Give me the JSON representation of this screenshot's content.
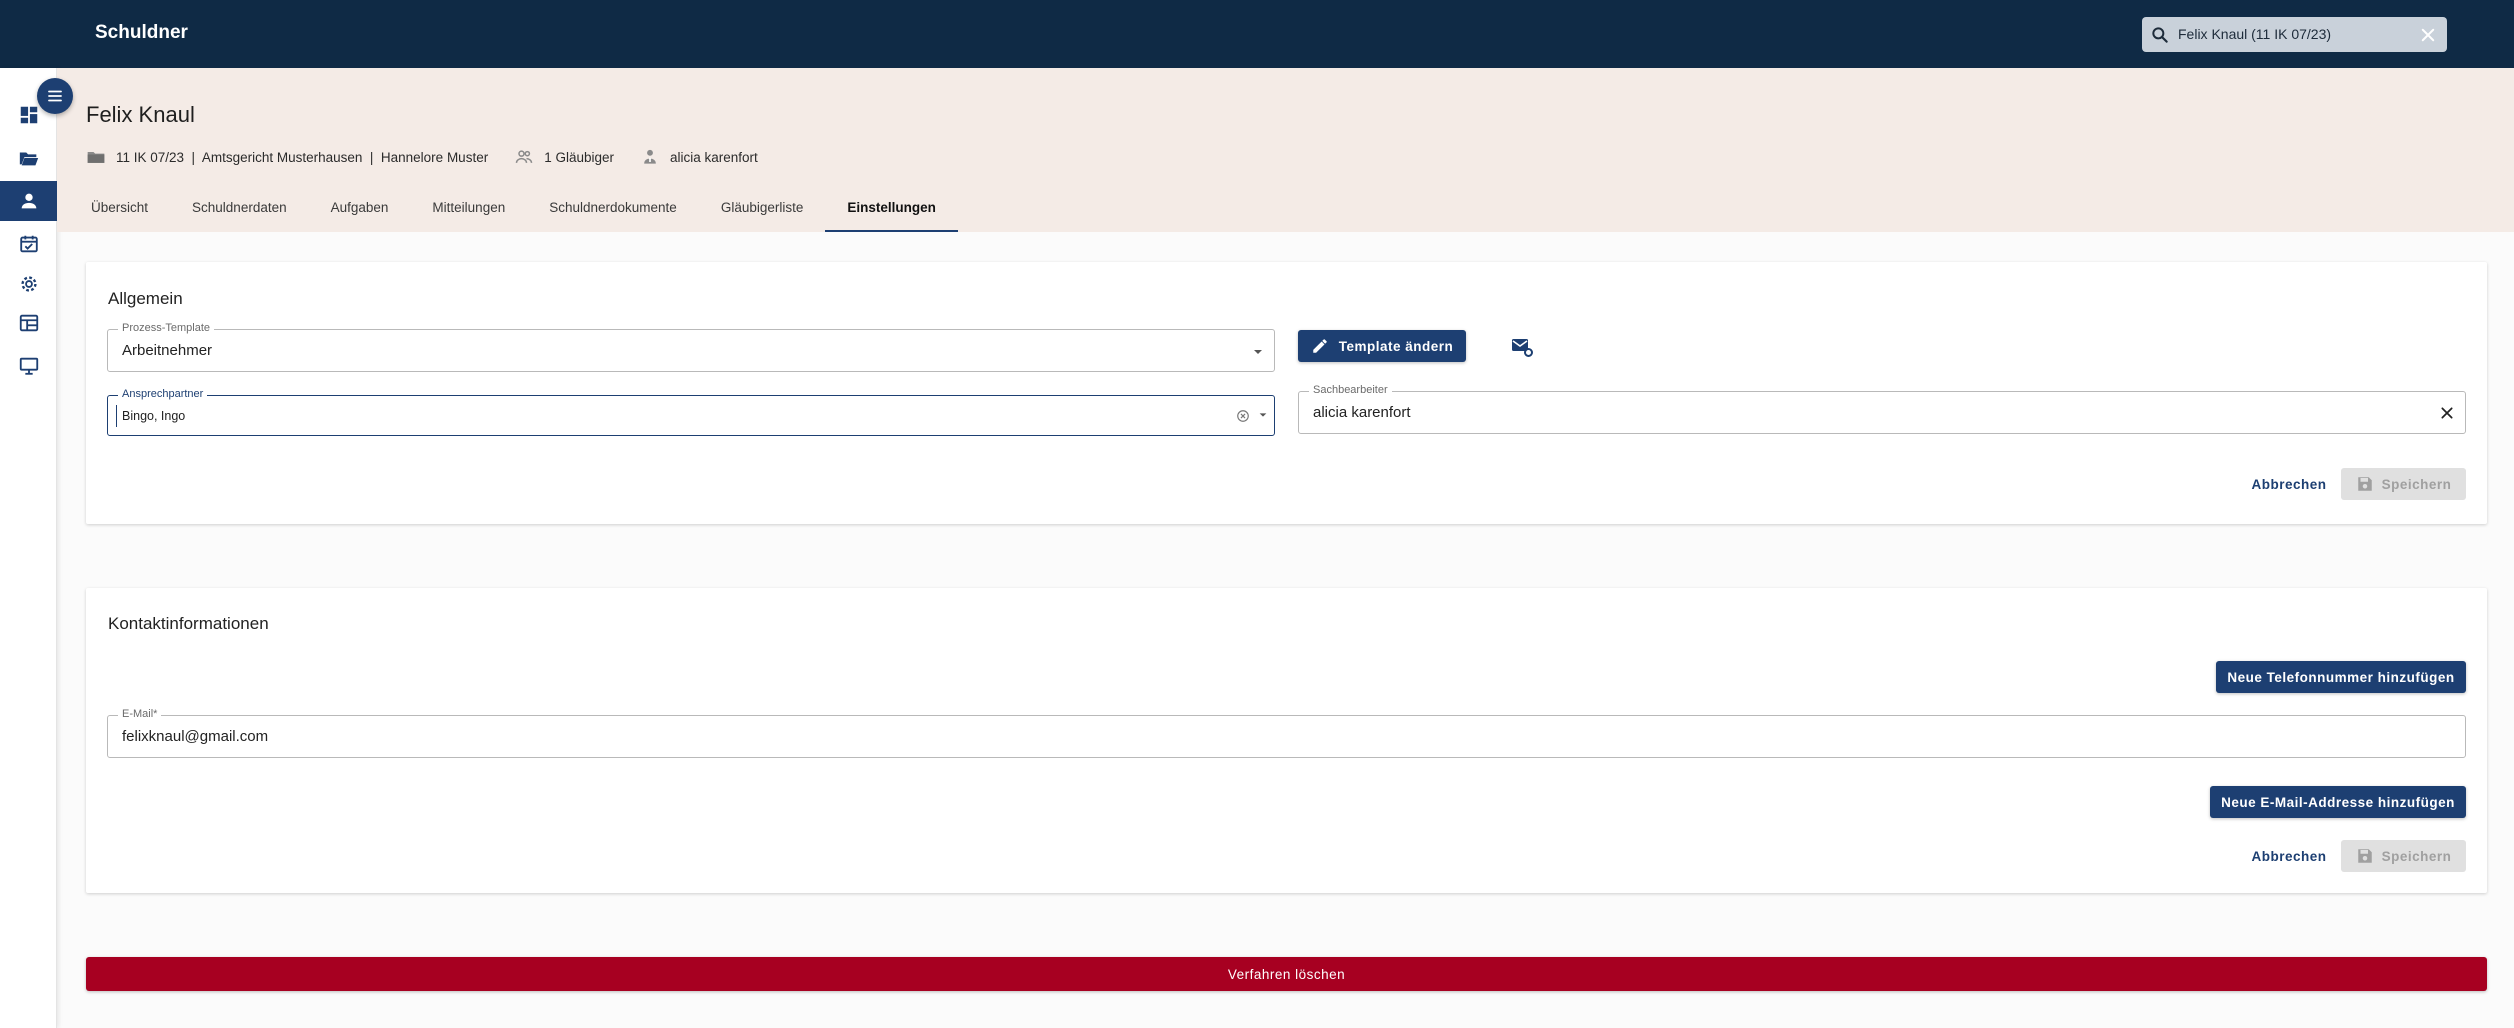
{
  "app": {
    "title": "Schuldner"
  },
  "search": {
    "value": "Felix Knaul (11 IK 07/23)"
  },
  "rail": {
    "items": [
      {
        "icon": "dashboard-icon"
      },
      {
        "icon": "folder-open-icon"
      },
      {
        "icon": "person-icon",
        "active": true
      },
      {
        "icon": "calendar-check-icon"
      },
      {
        "icon": "gear-icon"
      },
      {
        "icon": "table-layout-icon"
      },
      {
        "icon": "monitor-icon"
      }
    ]
  },
  "header": {
    "name": "Felix Knaul",
    "case": "11 IK 07/23  |  Amtsgericht Musterhausen  |  Hannelore Muster",
    "creditors": "1 Gläubiger",
    "clerk": "alicia karenfort"
  },
  "tabs": [
    {
      "label": "Übersicht"
    },
    {
      "label": "Schuldnerdaten"
    },
    {
      "label": "Aufgaben"
    },
    {
      "label": "Mitteilungen"
    },
    {
      "label": "Schuldnerdokumente"
    },
    {
      "label": "Gläubigerliste"
    },
    {
      "label": "Einstellungen",
      "active": true
    }
  ],
  "general": {
    "title": "Allgemein",
    "template_label": "Prozess-Template",
    "template_value": "Arbeitnehmer",
    "template_button": "Template ändern",
    "contact_label": "Ansprechpartner",
    "contact_value": "Bingo, Ingo",
    "clerk_label": "Sachbearbeiter",
    "clerk_value": "alicia karenfort",
    "cancel": "Abbrechen",
    "save": "Speichern"
  },
  "contact": {
    "title": "Kontaktinformationen",
    "add_phone": "Neue Telefonnummer hinzufügen",
    "email_label": "E-Mail*",
    "email_value": "felixknaul@gmail.com",
    "add_email": "Neue E-Mail-Addresse hinzufügen",
    "cancel": "Abbrechen",
    "save": "Speichern"
  },
  "danger": {
    "delete": "Verfahren löschen"
  },
  "colors": {
    "primary": "#1d3f72",
    "topbar": "#0f2a45",
    "header_bg": "#f4ebe6",
    "danger": "#a70021"
  }
}
